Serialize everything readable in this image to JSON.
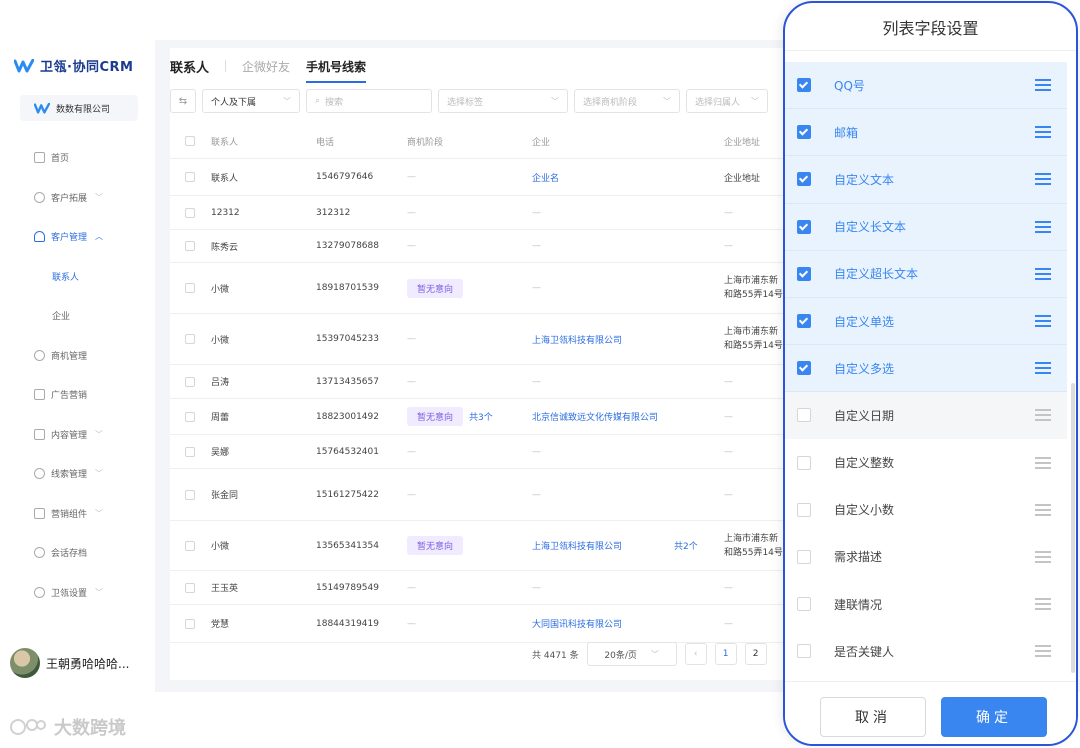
{
  "brand": {
    "name": "卫瓴·协同CRM",
    "company": "数数有限公司"
  },
  "nav": {
    "items": [
      {
        "label": "首页"
      },
      {
        "label": "客户拓展"
      },
      {
        "label": "客户管理"
      },
      {
        "label": "联系人"
      },
      {
        "label": "企业"
      },
      {
        "label": "商机管理"
      },
      {
        "label": "广告营销"
      },
      {
        "label": "内容管理"
      },
      {
        "label": "线索管理"
      },
      {
        "label": "营销组件"
      },
      {
        "label": "会话存档"
      },
      {
        "label": "卫瓴设置"
      }
    ]
  },
  "user": {
    "name": "王朝勇哈哈哈..."
  },
  "watermark": {
    "text": "大数跨境"
  },
  "tabs": {
    "contacts": "联系人",
    "wecom_friends": "企微好友",
    "phone_leads": "手机号线索"
  },
  "toolbar": {
    "owner": "个人及下属",
    "search_placeholder": "搜索",
    "tag_placeholder": "选择标签",
    "stage_placeholder": "选择商机阶段",
    "assignee_placeholder": "选择归属人"
  },
  "table": {
    "headers": {
      "contact": "联系人",
      "phone": "电话",
      "stage": "商机阶段",
      "company": "企业",
      "address": "企业地址"
    },
    "rows": [
      {
        "name": "联系人",
        "phone": "1546797646",
        "stage": "—",
        "company": "企业名",
        "count": "",
        "addr1": "企业地址",
        "addr2": ""
      },
      {
        "name": "12312",
        "phone": "312312",
        "stage": "—",
        "company": "—",
        "count": "",
        "addr1": "—",
        "addr2": ""
      },
      {
        "name": "陈秀云",
        "phone": "13279078688",
        "stage": "—",
        "company": "—",
        "count": "",
        "addr1": "—",
        "addr2": ""
      },
      {
        "name": "小微",
        "phone": "18918701539",
        "stage": "暂无意向",
        "company": "—",
        "count": "",
        "addr1": "上海市浦东新",
        "addr2": "和路55弄14号"
      },
      {
        "name": "小微",
        "phone": "15397045233",
        "stage": "—",
        "company": "上海卫瓴科技有限公司",
        "count": "",
        "addr1": "上海市浦东新",
        "addr2": "和路55弄14号"
      },
      {
        "name": "吕涛",
        "phone": "13713435657",
        "stage": "—",
        "company": "—",
        "count": "",
        "addr1": "—",
        "addr2": ""
      },
      {
        "name": "周蕾",
        "phone": "18823001492",
        "stage": "暂无意向",
        "stage_more": "共3个",
        "company": "北京信诚致远文化传媒有限公司",
        "count": "",
        "addr1": "—",
        "addr2": ""
      },
      {
        "name": "吴娜",
        "phone": "15764532401",
        "stage": "—",
        "company": "—",
        "count": "",
        "addr1": "—",
        "addr2": ""
      },
      {
        "name": "张金同",
        "phone": "15161275422",
        "stage": "—",
        "company": "—",
        "count": "",
        "addr1": "—",
        "addr2": ""
      },
      {
        "name": "小微",
        "phone": "13565341354",
        "stage": "暂无意向",
        "company": "上海卫瓴科技有限公司",
        "count": "共2个",
        "addr1": "上海市浦东新",
        "addr2": "和路55弄14号"
      },
      {
        "name": "王玉英",
        "phone": "15149789549",
        "stage": "—",
        "company": "—",
        "count": "",
        "addr1": "—",
        "addr2": ""
      },
      {
        "name": "党慧",
        "phone": "18844319419",
        "stage": "—",
        "company": "大同国讯科技有限公司",
        "count": "",
        "addr1": "—",
        "addr2": ""
      }
    ]
  },
  "pagination": {
    "total": "共 4471 条",
    "page_size": "20条/页",
    "page_1": "1",
    "page_2": "2"
  },
  "drawer": {
    "title": "列表字段设置",
    "fields": [
      {
        "label": "QQ号",
        "checked": true
      },
      {
        "label": "邮箱",
        "checked": true
      },
      {
        "label": "自定义文本",
        "checked": true
      },
      {
        "label": "自定义长文本",
        "checked": true
      },
      {
        "label": "自定义超长文本",
        "checked": true
      },
      {
        "label": "自定义单选",
        "checked": true
      },
      {
        "label": "自定义多选",
        "checked": true
      },
      {
        "label": "自定义日期",
        "checked": false
      },
      {
        "label": "自定义整数",
        "checked": false
      },
      {
        "label": "自定义小数",
        "checked": false
      },
      {
        "label": "需求描述",
        "checked": false
      },
      {
        "label": "建联情况",
        "checked": false
      },
      {
        "label": "是否关键人",
        "checked": false
      }
    ],
    "cancel": "取消",
    "confirm": "确定"
  },
  "colors": {
    "accent": "#3a86f0",
    "brand": "#1a3b8f",
    "tag_bg": "#f0ebff",
    "frame": "#2b55d8"
  }
}
